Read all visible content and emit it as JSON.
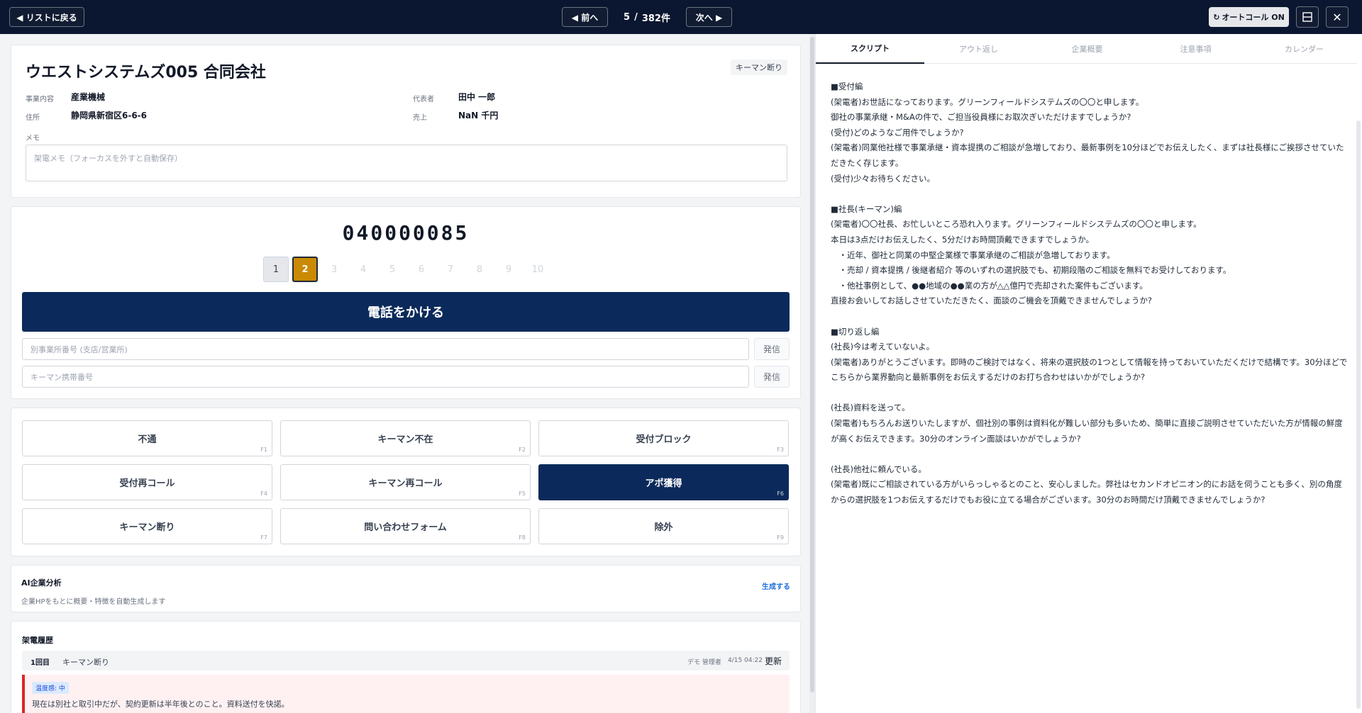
{
  "topbar": {
    "back_label": "◀ リストに戻る",
    "prev_label": "◀ 前へ",
    "next_label": "次へ ▶",
    "current": "5",
    "separator": "/",
    "total": "382件",
    "autocall_icon": "↻",
    "autocall_label": "オートコール ON",
    "layout_icon": "panel-icon",
    "close_icon": "✕"
  },
  "company": {
    "name": "ウエストシステムズ005 合同会社",
    "status_badge": "キーマン断り",
    "business_label": "事業内容",
    "business_value": "産業機械",
    "address_label": "住所",
    "address_value": "静岡県新宿区6-6-6",
    "rep_label": "代表者",
    "rep_value": "田中 一郎",
    "sales_label": "売上",
    "sales_value": "NaN 千円",
    "memo_label": "メモ",
    "memo_placeholder": "架電メモ（フォーカスを外すと自動保存）"
  },
  "phone": {
    "number": "040000085",
    "attempts": [
      "1",
      "2",
      "3",
      "4",
      "5",
      "6",
      "7",
      "8",
      "9",
      "10"
    ],
    "call_label": "電話をかける",
    "branch_placeholder": "別事業所番号 (支店/営業所)",
    "keyman_placeholder": "キーマン携帯番号",
    "dial_label": "発信"
  },
  "results": [
    {
      "label": "不通",
      "key": "F1"
    },
    {
      "label": "キーマン不在",
      "key": "F2"
    },
    {
      "label": "受付ブロック",
      "key": "F3"
    },
    {
      "label": "受付再コール",
      "key": "F4"
    },
    {
      "label": "キーマン再コール",
      "key": "F5"
    },
    {
      "label": "アポ獲得",
      "key": "F6"
    },
    {
      "label": "キーマン断り",
      "key": "F7"
    },
    {
      "label": "問い合わせフォーム",
      "key": "F8"
    },
    {
      "label": "除外",
      "key": "F9"
    }
  ],
  "ai": {
    "title": "AI企業分析",
    "description": "企業HPをもとに概要・特徴を自動生成します",
    "generate_label": "生成する"
  },
  "history": {
    "title": "架電履歴",
    "round": "1回目",
    "result": "キーマン断り",
    "user": "デモ 管理者",
    "time": "4/15 04:22",
    "update_label": "更新",
    "temperature": "温度感: 中",
    "note": "現在は別社と取引中だが、契約更新は半年後とのこと。資料送付を快諾。"
  },
  "tabs": [
    "スクリプト",
    "アウト返し",
    "企業概要",
    "注意事項",
    "カレンダー"
  ],
  "script": {
    "lines": [
      "■受付編",
      "(架電者)お世話になっております。グリーンフィールドシステムズの〇〇と申します。",
      "御社の事業承継・M&Aの件で、ご担当役員様にお取次ぎいただけますでしょうか?",
      "(受付)どのようなご用件でしょうか?",
      "(架電者)同業他社様で事業承継・資本提携のご相談が急増しており、最新事例を10分ほどでお伝えしたく、まずは社長様にご挨拶させていただきたく存じます。",
      "(受付)少々お待ちください。",
      "",
      "■社長(キーマン)編",
      "(架電者)〇〇社長、お忙しいところ恐れ入ります。グリーンフィールドシステムズの〇〇と申します。",
      "本日は3点だけお伝えしたく、5分だけお時間頂戴できますでしょうか。",
      "　・近年、御社と同業の中堅企業様で事業承継のご相談が急増しております。",
      "　・売却 / 資本提携 / 後継者紹介 等のいずれの選択肢でも、初期段階のご相談を無料でお受けしております。",
      "　・他社事例として、●●地域の●●業の方が△△億円で売却された案件もございます。",
      "直接お会いしてお話しさせていただきたく、面談のご機会を頂戴できませんでしょうか?",
      "",
      "■切り返し編",
      "(社長)今は考えていないよ。",
      "(架電者)ありがとうございます。即時のご検討ではなく、将来の選択肢の1つとして情報を持っておいていただくだけで結構です。30分ほどでこちらから業界動向と最新事例をお伝えするだけのお打ち合わせはいかがでしょうか?",
      "",
      "(社長)資料を送って。",
      "(架電者)もちろんお送りいたしますが、個社別の事例は資料化が難しい部分も多いため、簡単に直接ご説明させていただいた方が情報の鮮度が高くお伝えできます。30分のオンライン面談はいかがでしょうか?",
      "",
      "(社長)他社に頼んでいる。",
      "(架電者)既にご相談されている方がいらっしゃるとのこと、安心しました。弊社はセカンドオピニオン的にお話を伺うことも多く、別の角度からの選択肢を1つお伝えするだけでもお役に立てる場合がございます。30分のお時間だけ頂戴できませんでしょうか?"
    ]
  },
  "colors": {
    "topbar": "#0b1730",
    "primary": "#0b2a5b",
    "active_attempt": "#ca8a04",
    "history_accent": "#dc2626"
  }
}
